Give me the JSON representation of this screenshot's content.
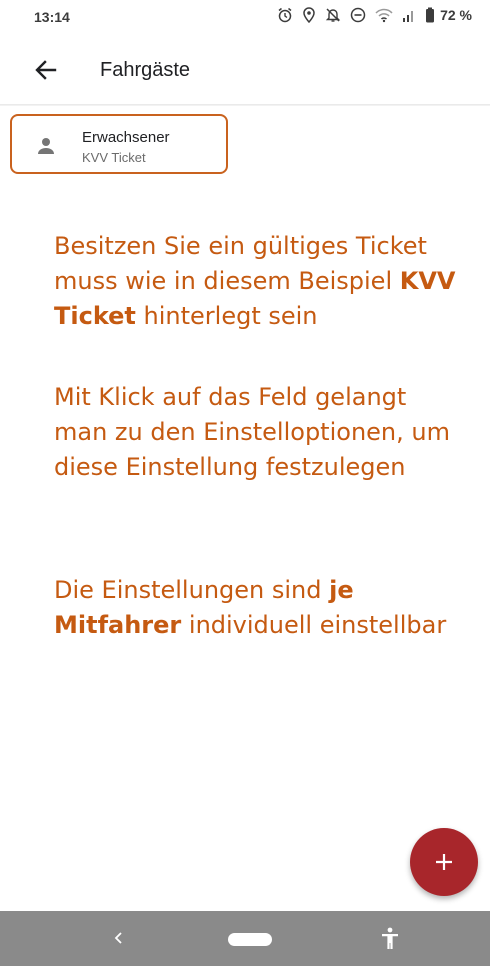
{
  "status_bar": {
    "time": "13:14",
    "battery_percent": "72 %",
    "icons": [
      "alarm-icon",
      "location-icon",
      "notifications-off-icon",
      "do-not-disturb-icon",
      "wifi-icon",
      "signal-icon",
      "battery-icon"
    ]
  },
  "app_bar": {
    "back_icon": "arrow-left-icon",
    "title": "Fahrgäste"
  },
  "passengers": [
    {
      "name": "Erwachsener",
      "ticket": "KVV Ticket",
      "icon": "person-icon"
    }
  ],
  "annotations": {
    "p1": {
      "t1": "Besitzen Sie ein gültiges Ticket muss wie in diesem Beispiel ",
      "b1": "KVV Ticket",
      "t2": " hinterlegt sein"
    },
    "p2": {
      "t1": "Mit Klick auf das Feld gelangt man zu den Einstelloptionen, um diese Einstellung festzulegen"
    },
    "p3": {
      "t1": "Die Einstellungen sind ",
      "b1": "je Mitfahrer",
      "t2": " individuell einstellbar"
    }
  },
  "fab": {
    "icon": "plus-icon"
  },
  "nav_bar": {
    "icons": [
      "nav-back-icon",
      "nav-home-pill",
      "accessibility-icon"
    ]
  },
  "colors": {
    "accent": "#c9621e",
    "annotation_text": "#c55a11",
    "fab": "#a8262b",
    "nav_bar": "#8a8a8a"
  }
}
